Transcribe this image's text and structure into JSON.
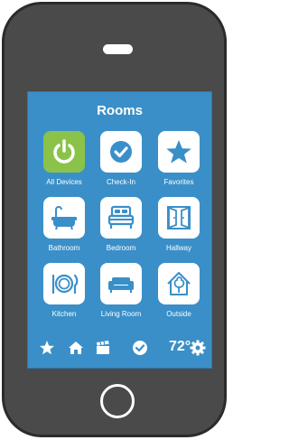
{
  "screen": {
    "title": "Rooms",
    "tiles": [
      {
        "label": "All Devices",
        "icon": "power-icon"
      },
      {
        "label": "Check-In",
        "icon": "check-circle-icon"
      },
      {
        "label": "Favorites",
        "icon": "star-icon"
      },
      {
        "label": "Bathroom",
        "icon": "bathtub-icon"
      },
      {
        "label": "Bedroom",
        "icon": "bed-icon"
      },
      {
        "label": "Hallway",
        "icon": "door-icon"
      },
      {
        "label": "Kitchen",
        "icon": "plate-icon"
      },
      {
        "label": "Living Room",
        "icon": "sofa-icon"
      },
      {
        "label": "Outside",
        "icon": "tree-house-icon"
      }
    ]
  },
  "bottom_bar": {
    "icons": [
      "star-icon",
      "home-icon",
      "clapperboard-icon",
      "check-circle-icon",
      "gear-icon"
    ],
    "temperature": "72°"
  },
  "colors": {
    "phone_body": "#4a4a4a",
    "screen_bg": "#3a8fc8",
    "tile_bg": "#ffffff",
    "active_tile": "#8bc34a",
    "icon_blue": "#3a8fc8"
  }
}
